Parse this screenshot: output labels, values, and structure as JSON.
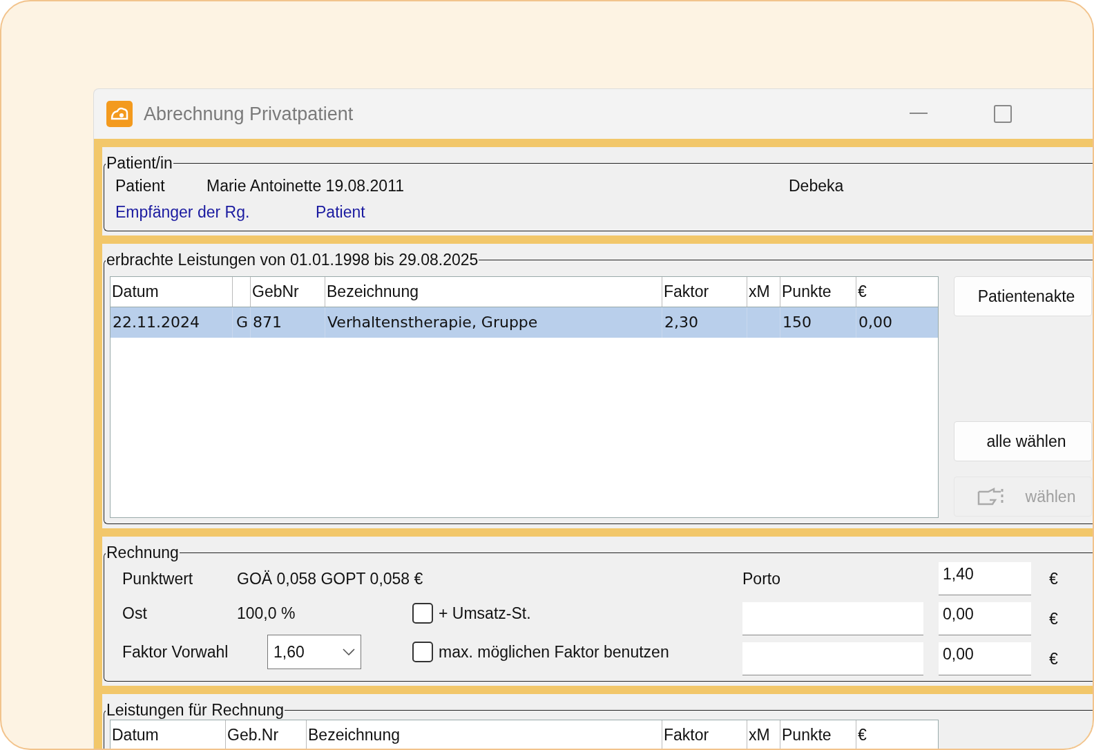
{
  "window": {
    "title": "Abrechnung Privatpatient"
  },
  "patient_group": {
    "title": "Patient/in",
    "patient": {
      "label": "Patient",
      "value": "Marie Antoinette 19.08.2011",
      "insurer": "Debeka"
    },
    "recipient": {
      "label": "Empfänger der Rg.",
      "value": "Patient"
    }
  },
  "services": {
    "title": "erbrachte Leistungen von 01.01.1998 bis 29.08.2025",
    "columns": [
      {
        "label": "Datum"
      },
      {},
      {
        "label": "GebNr"
      },
      {
        "label": "Bezeichnung"
      },
      {
        "label": "Faktor"
      },
      {
        "label": "xM"
      },
      {
        "label": "Punkte"
      },
      {
        "label": "€"
      }
    ],
    "rows": [
      {
        "selected": true,
        "cells": [
          "22.11.2024",
          "G",
          "871",
          "Verhaltenstherapie, Gruppe",
          "2,30",
          null,
          "150",
          "0,00"
        ]
      }
    ],
    "buttons": [
      {
        "kind": "plain",
        "label": "Patientenakte",
        "disabled": false
      },
      {
        "kind": "plain",
        "label": "alle wählen",
        "disabled": false
      },
      {
        "kind": "icon",
        "label": "wählen",
        "disabled": true
      }
    ]
  },
  "invoice": {
    "title": "Rechnung",
    "punktwert": {
      "label": "Punktwert",
      "value": "GOÄ 0,058  GOPT 0,058 €"
    },
    "ost": {
      "label": "Ost",
      "value": "100,0 %"
    },
    "factor": {
      "label": "Faktor Vorwahl",
      "value": "1,60"
    },
    "checkboxes": [
      {
        "label": "+ Umsatz-St.",
        "checked": false
      },
      {
        "label": "max. möglichen Faktor benutzen",
        "checked": false
      }
    ],
    "amounts": [
      {
        "kind": "label",
        "label": "Porto",
        "value": "1,40",
        "currency": "€"
      },
      {
        "kind": "input",
        "value": "0,00",
        "currency": "€"
      },
      {
        "kind": "input",
        "value": "0,00",
        "currency": "€"
      }
    ]
  },
  "invoice_services": {
    "title": "Leistungen für Rechnung",
    "columns": [
      "Datum",
      "Geb.Nr",
      "Bezeichnung",
      "Faktor",
      "xM",
      "Punkte",
      "€"
    ]
  }
}
